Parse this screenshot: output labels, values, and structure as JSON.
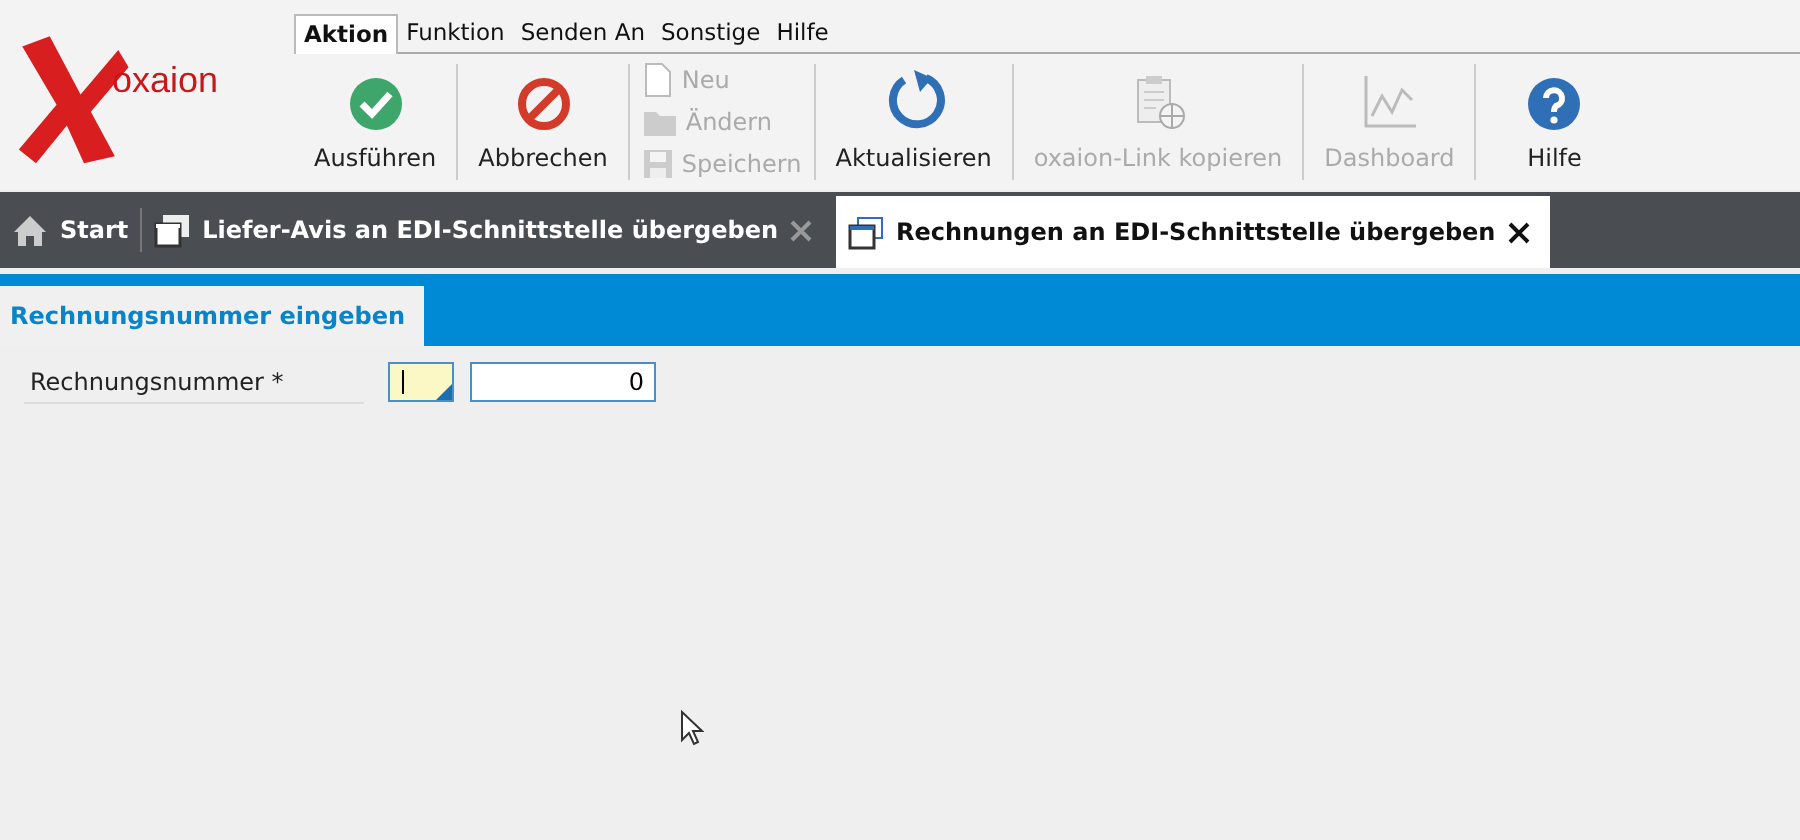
{
  "logo": {
    "text": "oxaion"
  },
  "menu": [
    {
      "label": "Aktion",
      "selected": true
    },
    {
      "label": "Funktion",
      "selected": false
    },
    {
      "label": "Senden An",
      "selected": false
    },
    {
      "label": "Sonstige",
      "selected": false
    },
    {
      "label": "Hilfe",
      "selected": false
    }
  ],
  "toolbar": [
    {
      "kind": "large",
      "label": "Ausführen",
      "disabled": false
    },
    {
      "kind": "large",
      "label": "Abbrechen",
      "disabled": false
    },
    {
      "kind": "stack",
      "items": [
        {
          "label": "Neu",
          "disabled": true
        },
        {
          "label": "Ändern",
          "disabled": true
        },
        {
          "label": "Speichern",
          "disabled": true
        }
      ]
    },
    {
      "kind": "large",
      "label": "Aktualisieren",
      "disabled": false
    },
    {
      "kind": "large",
      "label": "oxaion-Link kopieren",
      "disabled": true
    },
    {
      "kind": "large",
      "label": "Dashboard",
      "disabled": true
    },
    {
      "kind": "large",
      "label": "Hilfe",
      "disabled": false
    }
  ],
  "doc_tabs": [
    {
      "kind": "home",
      "label": "Start",
      "selected": false
    },
    {
      "kind": "window",
      "label": "Liefer-Avis an EDI-Schnittstelle übergeben",
      "selected": false
    },
    {
      "kind": "window",
      "label": "Rechnungen an EDI-Schnittstelle übergeben",
      "selected": true
    }
  ],
  "section_tab": {
    "label": "Rechnungsnummer eingeben"
  },
  "form": [
    {
      "label": "Rechnungsnummer *",
      "value": "0"
    }
  ]
}
